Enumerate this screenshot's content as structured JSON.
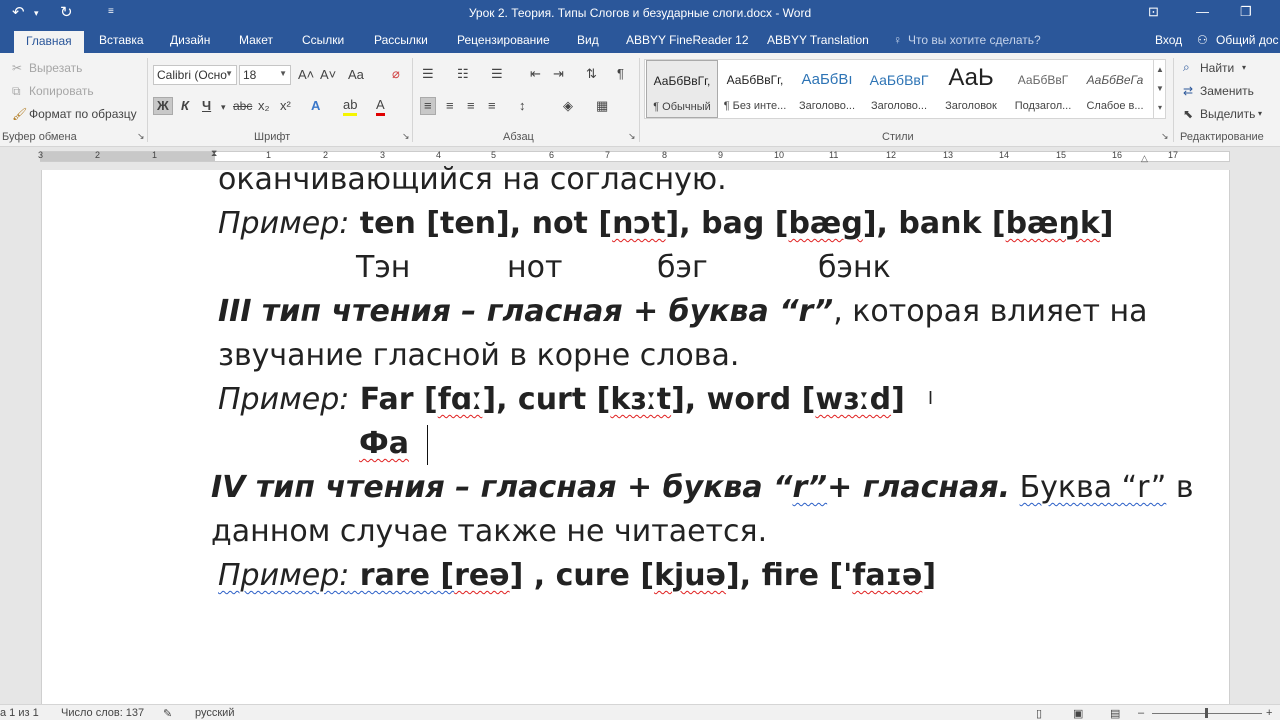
{
  "titlebar": {
    "title": "Урок 2. Теория. Типы Слогов и безударные слоги.docx - Word",
    "undo_icon": "undo-icon",
    "redo_icon": "redo-icon",
    "customize_icon": "customize-qat-icon"
  },
  "tabs": [
    "Главная",
    "Вставка",
    "Дизайн",
    "Макет",
    "Ссылки",
    "Рассылки",
    "Рецензирование",
    "Вид",
    "ABBYY FineReader 12",
    "ABBYY Translation"
  ],
  "tell_me": "Что вы хотите сделать?",
  "signin": "Вход",
  "share": "Общий дос",
  "clipboard": {
    "cut": "Вырезать",
    "copy": "Копировать",
    "format_painter": "Формат по образцу",
    "group": "Буфер обмена"
  },
  "font": {
    "name": "Calibri (Осно",
    "size": "18",
    "group": "Шрифт",
    "bold": "Ж",
    "italic": "К",
    "underline": "Ч",
    "strike": "abc",
    "subscript": "x₂",
    "superscript": "x²",
    "grow": "A˄",
    "shrink": "A˅",
    "case": "Aa",
    "clear": "A",
    "effects": "A",
    "highlight": "ab",
    "color": "A"
  },
  "paragraph": {
    "group": "Абзац"
  },
  "styles": {
    "group": "Стили",
    "items": [
      {
        "sample": "АаБбВвГг,",
        "name": "¶ Обычный"
      },
      {
        "sample": "АаБбВвГг,",
        "name": "¶ Без инте..."
      },
      {
        "sample": "АаБбВı",
        "name": "Заголово..."
      },
      {
        "sample": "АаБбВвГ",
        "name": "Заголово..."
      },
      {
        "sample": "АаЬ",
        "name": "Заголовок"
      },
      {
        "sample": "АаБбВвГ",
        "name": "Подзагол..."
      },
      {
        "sample": "АаБбВеГа",
        "name": "Слабое в..."
      }
    ]
  },
  "editing": {
    "find": "Найти",
    "replace": "Заменить",
    "select": "Выделить",
    "group": "Редактирование"
  },
  "ruler": [
    "3",
    "2",
    "1",
    "1",
    "2",
    "3",
    "4",
    "5",
    "6",
    "7",
    "8",
    "9",
    "10",
    "11",
    "12",
    "13",
    "14",
    "15",
    "16",
    "17"
  ],
  "document": {
    "l1": "оканчивающийся на согласную.",
    "l2_prefix": "Пример:",
    "l2_bold": " ten [ten], not [",
    "l2_w1": "nɔt",
    "l2_mid": "], bag [",
    "l2_w2": "bæg",
    "l2_mid2": "], bank [",
    "l2_w3": "bæŋk",
    "l2_end": "]",
    "l3": [
      "Тэн",
      "нот",
      "бэг",
      "бэнк"
    ],
    "l4_bold": "III тип чтения – гласная + буква “r”",
    "l4_rest": ", которая влияет на",
    "l5": "звучание гласной в корне слова.",
    "l6_prefix": "Пример:",
    "l6_a": " Far [",
    "l6_w1": "fɑː",
    "l6_b": "], curt [",
    "l6_w2": "kɜːt",
    "l6_c": "], word [",
    "l6_w3": "wɜːd",
    "l6_d": "]",
    "l7": "Фа",
    "l8_bold": "IV тип чтения – гласная + буква “",
    "l8_r": "r”",
    "l8_bold2": "+ гласная.",
    "l8_rest1": " ",
    "l8_w": "Буква  “r”",
    "l8_rest2": " в",
    "l9": "данном случае также не читается.",
    "l10_prefix": "Пример:",
    "l10_a": "  rare [",
    "l10_w1": "reə",
    "l10_b": "] , cure [",
    "l10_w2": "kjuə",
    "l10_c": "], fire ['",
    "l10_w3": "faɪə",
    "l10_d": "]"
  },
  "status": {
    "page": "а 1 из 1",
    "words": "Число слов: 137",
    "language": "русский"
  }
}
